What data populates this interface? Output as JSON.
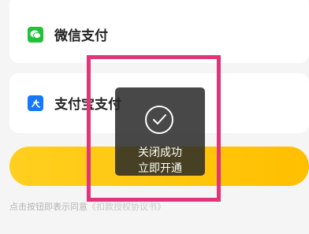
{
  "payment": {
    "wechat_label": "微信支付",
    "alipay_label": "支付宝支付"
  },
  "notice": {
    "prefix": "点击按钮即表示同意",
    "agreement_link": "《扣款授权协议书》"
  },
  "toast": {
    "line1": "关闭成功",
    "line2": "立即开通"
  },
  "icons": {
    "wechat": "wechat-pay-icon",
    "alipay": "alipay-icon",
    "toast": "check-circle-icon"
  },
  "colors": {
    "confirm_button": "#ffc107",
    "highlight_border": "#e0357a",
    "wechat_green": "#20c23b",
    "alipay_blue": "#1677ff"
  }
}
